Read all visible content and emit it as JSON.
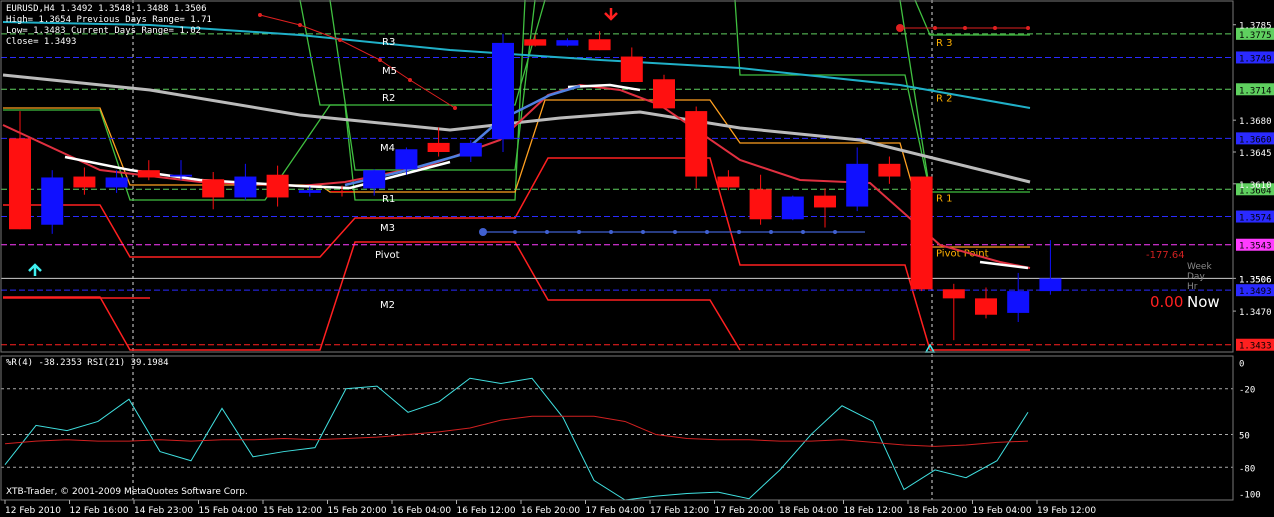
{
  "header": {
    "symbol_line": "EURUSD,H4  1.3492 1.3548 1.3488 1.3506",
    "high_line": "High= 1.3654    Previous Days Range= 1.71",
    "low_line": "Low= 1.3483    Current Days Range= 1.02",
    "close_line": "Close= 1.3493"
  },
  "indicator": {
    "label": "%R(4) -38.2353  RSI(21) 39.1984",
    "copyright": "XTB-Trader, © 2001-2009 MetaQuotes Software Corp."
  },
  "chart_data": {
    "type": "candlestick",
    "price_axis": {
      "ylim": [
        1.3425,
        1.381
      ],
      "ticks": [
        "1.3785",
        "1.3680",
        "1.3645",
        "1.3610",
        "1.3506",
        "1.3470"
      ]
    },
    "time_ticks": [
      "12 Feb 2010",
      "12 Feb 16:00",
      "14 Feb 23:00",
      "15 Feb 04:00",
      "15 Feb 12:00",
      "15 Feb 20:00",
      "16 Feb 04:00",
      "16 Feb 12:00",
      "16 Feb 20:00",
      "17 Feb 04:00",
      "17 Feb 12:00",
      "17 Feb 20:00",
      "18 Feb 04:00",
      "18 Feb 12:00",
      "18 Feb 20:00",
      "19 Feb 04:00",
      "19 Feb 12:00"
    ],
    "candles": [
      {
        "o": 1.366,
        "h": 1.369,
        "l": 1.356,
        "c": 1.356
      },
      {
        "o": 1.3565,
        "h": 1.3625,
        "l": 1.3555,
        "c": 1.3617
      },
      {
        "o": 1.3618,
        "h": 1.3628,
        "l": 1.3598,
        "c": 1.3606
      },
      {
        "o": 1.3606,
        "h": 1.3625,
        "l": 1.36,
        "c": 1.3617
      },
      {
        "o": 1.3625,
        "h": 1.3636,
        "l": 1.3614,
        "c": 1.3617
      },
      {
        "o": 1.3618,
        "h": 1.3636,
        "l": 1.3614,
        "c": 1.362
      },
      {
        "o": 1.3615,
        "h": 1.3623,
        "l": 1.3582,
        "c": 1.3595
      },
      {
        "o": 1.3595,
        "h": 1.3632,
        "l": 1.3592,
        "c": 1.3618
      },
      {
        "o": 1.362,
        "h": 1.363,
        "l": 1.3585,
        "c": 1.3595
      },
      {
        "o": 1.36,
        "h": 1.3607,
        "l": 1.3596,
        "c": 1.3603
      },
      {
        "o": 1.3602,
        "h": 1.3608,
        "l": 1.3596,
        "c": 1.3601
      },
      {
        "o": 1.3605,
        "h": 1.3626,
        "l": 1.3597,
        "c": 1.3625
      },
      {
        "o": 1.3626,
        "h": 1.365,
        "l": 1.362,
        "c": 1.3648
      },
      {
        "o": 1.3655,
        "h": 1.3672,
        "l": 1.364,
        "c": 1.3645
      },
      {
        "o": 1.364,
        "h": 1.3658,
        "l": 1.3634,
        "c": 1.3655
      },
      {
        "o": 1.3659,
        "h": 1.3775,
        "l": 1.3645,
        "c": 1.3765
      },
      {
        "o": 1.3769,
        "h": 1.3774,
        "l": 1.3761,
        "c": 1.3762
      },
      {
        "o": 1.3762,
        "h": 1.377,
        "l": 1.3761,
        "c": 1.3768
      },
      {
        "o": 1.3769,
        "h": 1.3778,
        "l": 1.3757,
        "c": 1.3757
      },
      {
        "o": 1.375,
        "h": 1.376,
        "l": 1.3722,
        "c": 1.3722
      },
      {
        "o": 1.3725,
        "h": 1.373,
        "l": 1.3693,
        "c": 1.3693
      },
      {
        "o": 1.369,
        "h": 1.3695,
        "l": 1.3605,
        "c": 1.3618
      },
      {
        "o": 1.3618,
        "h": 1.3625,
        "l": 1.3603,
        "c": 1.3606
      },
      {
        "o": 1.3604,
        "h": 1.362,
        "l": 1.3565,
        "c": 1.3571
      },
      {
        "o": 1.3571,
        "h": 1.3597,
        "l": 1.357,
        "c": 1.3596
      },
      {
        "o": 1.3597,
        "h": 1.3605,
        "l": 1.3562,
        "c": 1.3584
      },
      {
        "o": 1.3585,
        "h": 1.365,
        "l": 1.358,
        "c": 1.3632
      },
      {
        "o": 1.3632,
        "h": 1.364,
        "l": 1.361,
        "c": 1.3618
      },
      {
        "o": 1.3618,
        "h": 1.3618,
        "l": 1.3492,
        "c": 1.3494
      },
      {
        "o": 1.3494,
        "h": 1.35,
        "l": 1.3438,
        "c": 1.3484
      },
      {
        "o": 1.3484,
        "h": 1.3496,
        "l": 1.3462,
        "c": 1.3466
      },
      {
        "o": 1.3468,
        "h": 1.3512,
        "l": 1.3458,
        "c": 1.3492
      },
      {
        "o": 1.3492,
        "h": 1.3548,
        "l": 1.3488,
        "c": 1.3506
      }
    ],
    "levels": [
      {
        "name": "R 3",
        "value": 1.3775,
        "color": "#5fd05f",
        "label": "1.3775"
      },
      {
        "name": "",
        "value": 1.3749,
        "color": "#2a2aff",
        "label": "1.3749"
      },
      {
        "name": "R 2",
        "value": 1.3714,
        "color": "#5fd05f",
        "label": "1.3714"
      },
      {
        "name": "",
        "value": 1.366,
        "color": "#2a2aff",
        "label": "1.3660"
      },
      {
        "name": "R 1",
        "value": 1.3604,
        "color": "#5fd05f",
        "label": "1.3604"
      },
      {
        "name": "",
        "value": 1.3574,
        "color": "#2a2aff",
        "label": "1.3574"
      },
      {
        "name": "Pivot Point",
        "value": 1.3543,
        "color": "#ff3cff",
        "label": "1.3543"
      },
      {
        "name": "",
        "value": 1.3493,
        "color": "#2a2aff",
        "label": "1.3493"
      },
      {
        "name": "",
        "value": 1.3433,
        "color": "#ff2020",
        "label": "1.3433"
      }
    ],
    "current_price": {
      "value": 1.3506,
      "label": "1.3506"
    },
    "overlay_labels": [
      "R3",
      "M5",
      "R2",
      "M4",
      "R1",
      "M3",
      "Pivot",
      "M2"
    ],
    "annotations": {
      "profit": "-177.64",
      "counter": "0.00",
      "now": "Now",
      "week": "Week",
      "day": "Day",
      "hr": "Hr"
    },
    "oscillator": {
      "ylim": [
        -105,
        5
      ],
      "ticks": [
        "0",
        "-20",
        "50",
        "-80",
        "-100"
      ],
      "wpr": [
        -78,
        -48,
        -52,
        -45,
        -28,
        -68,
        -75,
        -35,
        -72,
        -68,
        -65,
        -20,
        -18,
        -38,
        -30,
        -12,
        -16,
        -12,
        -42,
        -90,
        -105,
        -102,
        -100,
        -99,
        -104,
        -82,
        -55,
        -33,
        -45,
        -97,
        -82,
        -88,
        -75,
        -38
      ],
      "rsi": [
        -62,
        -60,
        -59,
        -60,
        -60,
        -59,
        -60,
        -59,
        -59,
        -58,
        -59,
        -58,
        -57,
        -55,
        -53,
        -50,
        -44,
        -41,
        -41,
        -41,
        -45,
        -55,
        -58,
        -59,
        -59,
        -60,
        -60,
        -59,
        -61,
        -63,
        -64,
        -63,
        -61,
        -60
      ]
    }
  }
}
